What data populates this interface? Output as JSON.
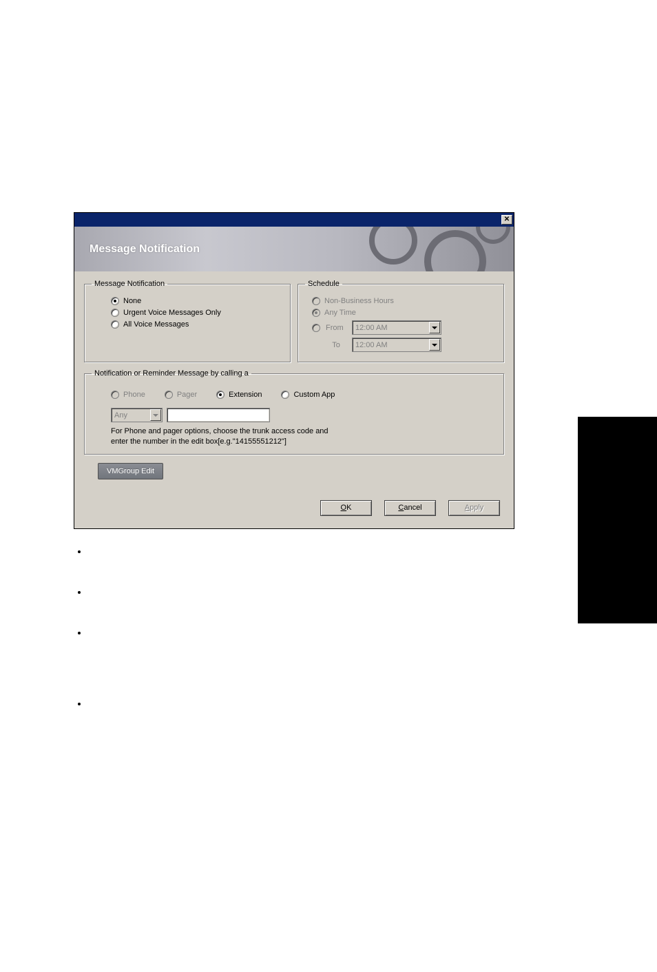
{
  "banner": {
    "title": "Message Notification"
  },
  "groups": {
    "messageNotification": {
      "legend": "Message Notification",
      "options": {
        "none": "None",
        "urgent": "Urgent Voice Messages Only",
        "all": "All Voice Messages"
      },
      "selected": "none"
    },
    "schedule": {
      "legend": "Schedule",
      "options": {
        "nonBusiness": "Non-Business Hours",
        "anyTime": "Any Time",
        "fromLabel": "From",
        "toLabel": "To"
      },
      "fromValue": "12:00 AM",
      "toValue": "12:00 AM",
      "selected": "anyTime"
    },
    "callMethod": {
      "legend": "Notification or Reminder Message  by calling a",
      "options": {
        "phone": "Phone",
        "pager": "Pager",
        "extension": "Extension",
        "customApp": "Custom App"
      },
      "selected": "extension",
      "trunkValue": "Any",
      "numberValue": "",
      "helpText": "For Phone and pager options, choose the trunk access code and enter the number in the edit box[e.g.\"14155551212\"]"
    }
  },
  "buttons": {
    "vmgroup": "VMGroup Edit",
    "ok": "OK",
    "cancel": "Cancel",
    "apply": "Apply"
  }
}
